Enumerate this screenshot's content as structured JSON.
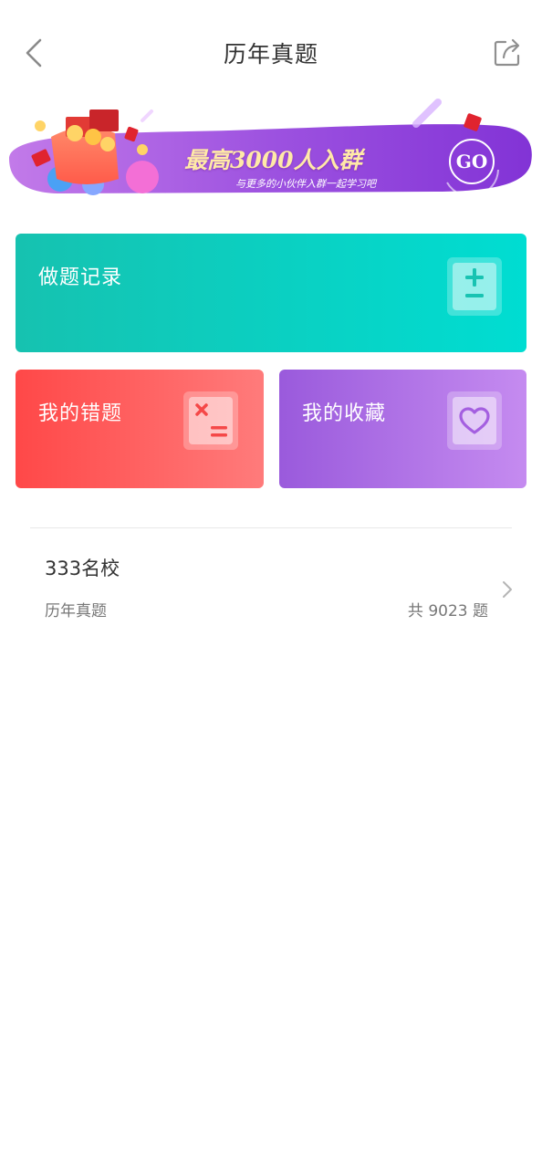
{
  "header": {
    "title": "历年真题",
    "back_icon": "chevron-left-icon",
    "share_icon": "share-icon"
  },
  "banner": {
    "headline": "最高3000人入群",
    "subtitle": "与更多的小伙伴入群一起学习吧",
    "go_label": "GO",
    "colors": {
      "start": "#b86ce8",
      "end": "#8a3ad8",
      "headline": "#ffe9a8"
    }
  },
  "cards": {
    "record": {
      "label": "做题记录",
      "icon": "plus-minus-icon",
      "color": "#00d0c4"
    },
    "wrong": {
      "label": "我的错题",
      "icon": "wrong-answer-icon",
      "color": "#ff5a5a"
    },
    "favorites": {
      "label": "我的收藏",
      "icon": "heart-icon",
      "color": "#b072e6"
    }
  },
  "list": {
    "items": [
      {
        "title": "333名校",
        "subtitle": "历年真题",
        "count": "共 9023 题"
      }
    ]
  }
}
